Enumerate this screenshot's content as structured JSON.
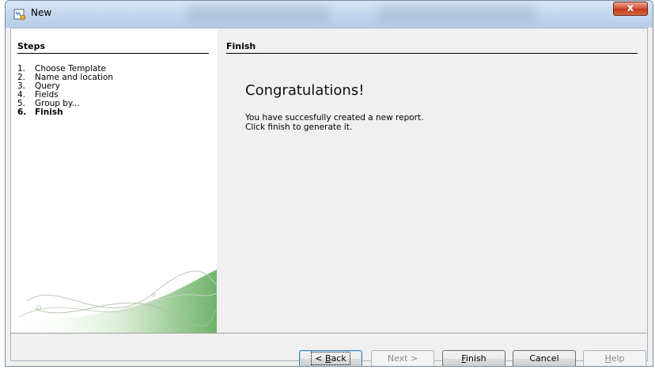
{
  "window": {
    "title": "New",
    "close_glyph": "x"
  },
  "steps": {
    "heading": "Steps",
    "items": [
      {
        "num": "1.",
        "label": "Choose Template"
      },
      {
        "num": "2.",
        "label": "Name and location"
      },
      {
        "num": "3.",
        "label": "Query"
      },
      {
        "num": "4.",
        "label": "Fields"
      },
      {
        "num": "5.",
        "label": "Group by..."
      },
      {
        "num": "6.",
        "label": "Finish",
        "current": true
      }
    ]
  },
  "content": {
    "heading": "Finish",
    "congrats": "Congratulations!",
    "line1": "You have succesfully created a new report.",
    "line2": "Click finish to generate it."
  },
  "buttons": {
    "back": {
      "pre": "< ",
      "mnemonic": "B",
      "post": "ack"
    },
    "next": {
      "label": "Next >"
    },
    "finish": {
      "mnemonic": "F",
      "post": "inish"
    },
    "cancel": {
      "label": "Cancel"
    },
    "help": {
      "mnemonic": "H",
      "post": "elp"
    }
  },
  "colors": {
    "titlebar": "#c4d7ee",
    "close_button": "#c33b1e",
    "panel_bg": "#f0f0f0",
    "accent_green": "#5aa055"
  }
}
